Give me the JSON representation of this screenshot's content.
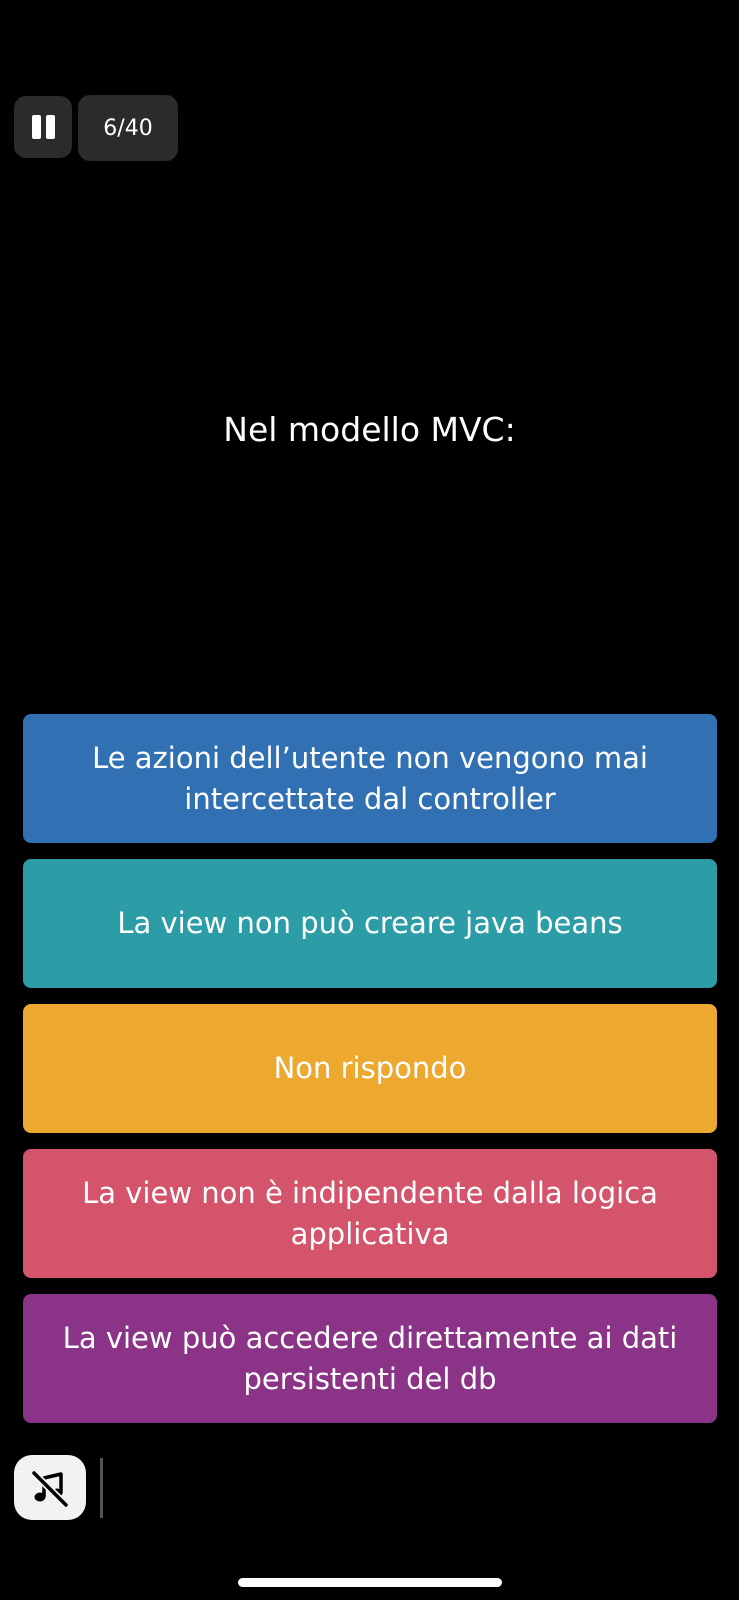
{
  "header": {
    "pause_icon": "pause-icon",
    "counter": "6/40"
  },
  "question": {
    "text": "Nel modello MVC:"
  },
  "answers": [
    {
      "label": "Le azioni dell’utente non vengono mai intercettate dal controller",
      "color": "#3270B4"
    },
    {
      "label": "La view non può creare java beans",
      "color": "#2C9DA6"
    },
    {
      "label": "Non rispondo",
      "color": "#ECA82F"
    },
    {
      "label": "La view non è indipendente dalla logica applicativa",
      "color": "#D4546B"
    },
    {
      "label": "La view può accedere direttamente ai dati persistenti del db",
      "color": "#8A3387"
    }
  ],
  "footer": {
    "music_icon": "music-off-icon"
  }
}
